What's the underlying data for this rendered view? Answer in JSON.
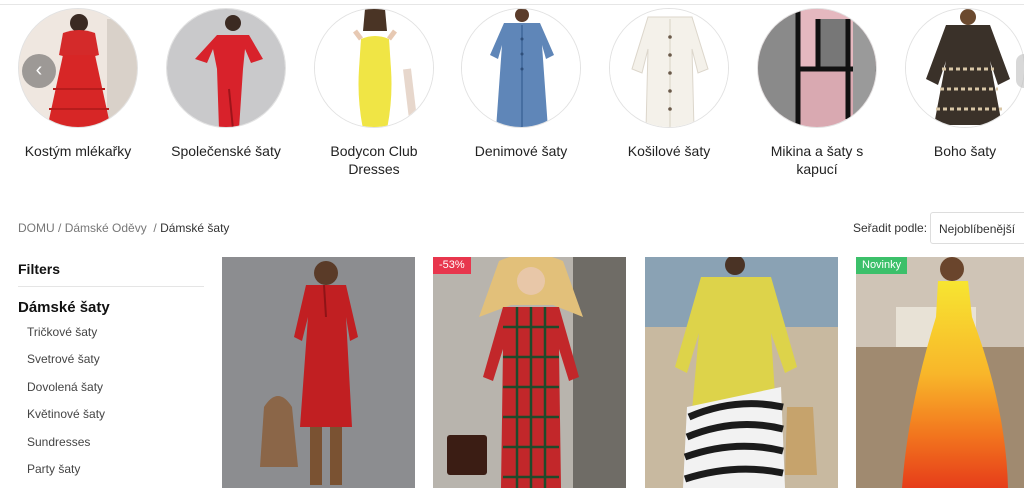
{
  "carousel": {
    "categories": [
      {
        "label": "Kostým mlékařky"
      },
      {
        "label": "Společenské šaty"
      },
      {
        "label": "Bodycon Club Dresses"
      },
      {
        "label": "Denimové šaty"
      },
      {
        "label": "Košilové šaty"
      },
      {
        "label": "Mikina a šaty s kapucí"
      },
      {
        "label": "Boho šaty"
      }
    ],
    "prev_icon": "‹"
  },
  "breadcrumb": {
    "home": "DOMU",
    "sep1": " / ",
    "parent": "Dámské Oděvy",
    "sep2": "  / ",
    "current": "Dámské šaty"
  },
  "sort": {
    "label": "Seřadit podle:",
    "selected": "Nejoblíbenější"
  },
  "sidebar": {
    "filters_title": "Filters",
    "category_title": "Dámské šaty",
    "subcategories": [
      "Tričkové šaty",
      "Svetrové šaty",
      "Dovolená šaty",
      "Květinové šaty",
      "Sundresses",
      "Party šaty"
    ]
  },
  "products": [
    {
      "badge": ""
    },
    {
      "badge": "-53%"
    },
    {
      "badge": ""
    },
    {
      "badge": "Novinky"
    }
  ],
  "colors": {
    "sale_badge": "#e8364d",
    "new_badge": "#3cc06a"
  }
}
